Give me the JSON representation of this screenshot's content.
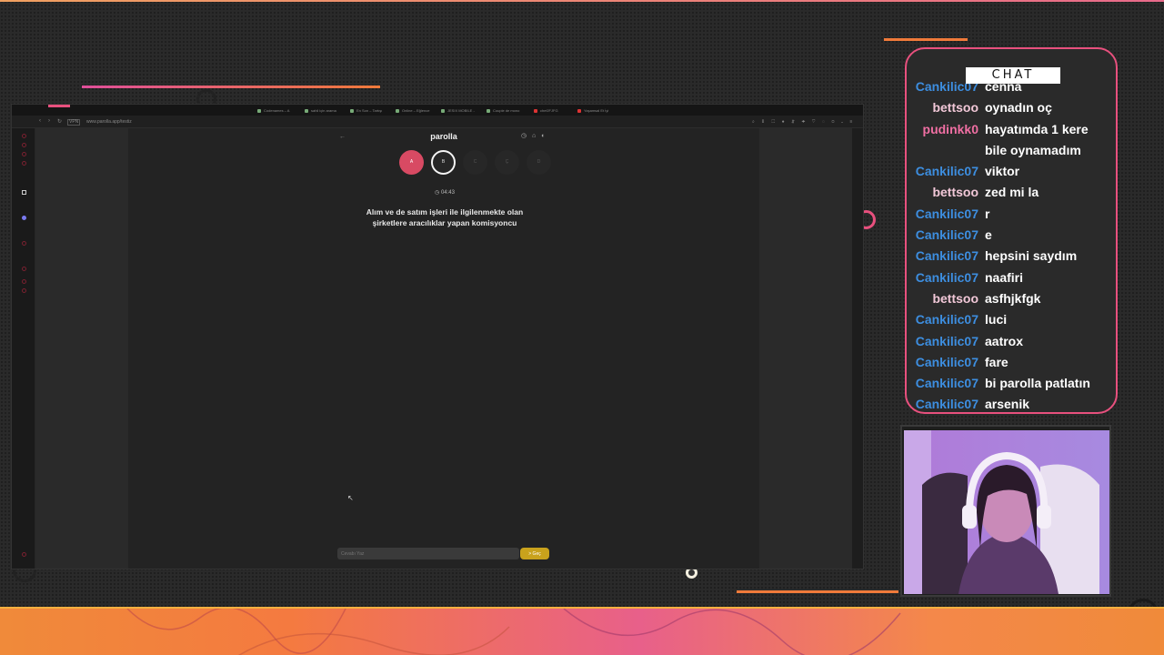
{
  "browser": {
    "tabs": [
      {
        "label": "Codenames – A",
        "fav": "green"
      },
      {
        "label": "sahil için arama",
        "fav": "green"
      },
      {
        "label": "En Son – Tartışı",
        "fav": "green"
      },
      {
        "label": "Online – Eğlence",
        "fav": "green"
      },
      {
        "label": "JESIX MOBILE -",
        "fav": "green"
      },
      {
        "label": "Couple de mono",
        "fav": "green"
      },
      {
        "label": "chefJFJFG",
        "fav": "red"
      },
      {
        "label": "Yaşamsal Et İyi",
        "fav": "red"
      }
    ],
    "url": "www.parolla.app/testiz",
    "url_badge": "VPN"
  },
  "parolla": {
    "back_icon": "arrow-left-icon",
    "title": "parolla",
    "letters": [
      "A",
      "B",
      "C",
      "Ç",
      "D"
    ],
    "timer": "04:43",
    "question": "Alım ve de satım işleri ile ilgilenmekte olan şirketlere aracılıklar yapan komisyoncu",
    "answer_placeholder": "Cevabı Yaz",
    "submit_label": "> Geç"
  },
  "chat": {
    "title": "CHAT",
    "messages": [
      {
        "user": "Cankilic07",
        "text": "cenna",
        "color": "#3d8ee0"
      },
      {
        "user": "bettsoo",
        "text": "oynadın oç",
        "color": "#f2c8d8"
      },
      {
        "user": "pudinkk0",
        "text": "hayatımda 1 kere bile oynamadım",
        "color": "#f06fa3"
      },
      {
        "user": "Cankilic07",
        "text": "viktor",
        "color": "#3d8ee0"
      },
      {
        "user": "bettsoo",
        "text": "zed mi la",
        "color": "#f2c8d8"
      },
      {
        "user": "Cankilic07",
        "text": "r",
        "color": "#3d8ee0"
      },
      {
        "user": "Cankilic07",
        "text": "e",
        "color": "#3d8ee0"
      },
      {
        "user": "Cankilic07",
        "text": "hepsini saydım",
        "color": "#3d8ee0"
      },
      {
        "user": "Cankilic07",
        "text": "naafiri",
        "color": "#3d8ee0"
      },
      {
        "user": "bettsoo",
        "text": "asfhjkfgk",
        "color": "#f2c8d8"
      },
      {
        "user": "Cankilic07",
        "text": "luci",
        "color": "#3d8ee0"
      },
      {
        "user": "Cankilic07",
        "text": "aatrox",
        "color": "#3d8ee0"
      },
      {
        "user": "Cankilic07",
        "text": "fare",
        "color": "#3d8ee0"
      },
      {
        "user": "Cankilic07",
        "text": "bi parolla patlatın",
        "color": "#3d8ee0"
      },
      {
        "user": "Cankilic07",
        "text": "arsenik",
        "color": "#3d8ee0"
      }
    ]
  },
  "colors": {
    "accent_pink": "#e8507e",
    "accent_orange": "#f07a3a",
    "letter_active": "#d84a63",
    "submit": "#c9a21c"
  }
}
